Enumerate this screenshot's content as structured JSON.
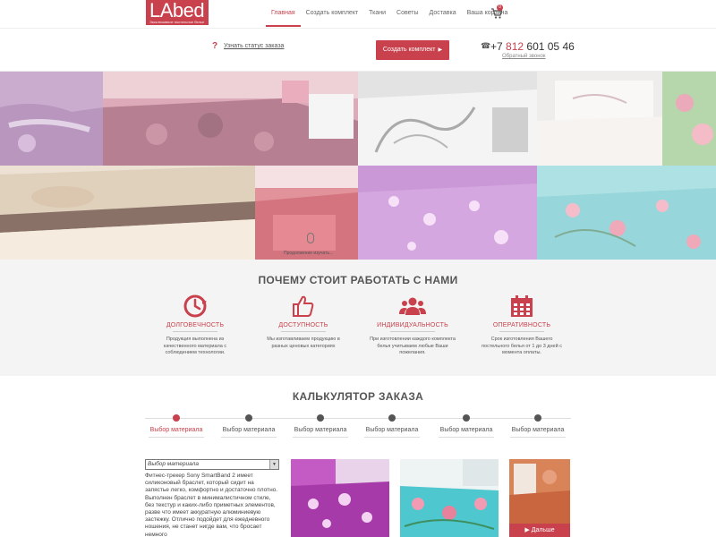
{
  "brand": {
    "name": "LAbed",
    "tagline": "Эксклюзивное постельное белье",
    "accent": "#c8414c"
  },
  "nav": {
    "items": [
      "Главная",
      "Создать комплект",
      "Ткани",
      "Советы",
      "Доставка",
      "Ваша корзина"
    ],
    "active": "Главная"
  },
  "cart": {
    "icon": "cart-icon",
    "count": "0"
  },
  "subbar": {
    "status_icon": "?",
    "status_link": "Узнать статус заказа",
    "create_button": "Создать комплект",
    "phone_icon": "☎",
    "phone_prefix": "+7",
    "phone_code": "812",
    "phone_number": "601 05 46",
    "callback": "Обратный звонок"
  },
  "hero": {
    "scroll_text": "Продолжение изучать..."
  },
  "why": {
    "title": "ПОЧЕМУ СТОИТ РАБОТАТЬ С НАМИ",
    "features": [
      {
        "icon": "durability-icon",
        "title": "ДОЛГОВЕЧНОСТЬ",
        "text": "Продукция выполнена из качественного материала с соблюдением технологии."
      },
      {
        "icon": "thumbs-up-icon",
        "title": "ДОСТУПНОСТЬ",
        "text": "Мы изготавливаем продукцию в разных ценовых категориях"
      },
      {
        "icon": "people-icon",
        "title": "ИНДИВИДУАЛЬНОСТЬ",
        "text": "При изготовлении каждого комплекта белья учитываем любые Ваши пожелания."
      },
      {
        "icon": "calendar-icon",
        "title": "ОПЕРАТИВНОСТЬ",
        "text": "Срок изготовления Вашего постельного белья от 1 до 3 дней с момента оплаты."
      }
    ]
  },
  "calculator": {
    "title": "КАЛЬКУЛЯТОР ЗАКАЗА",
    "steps": [
      "Выбор материала",
      "Выбор материала",
      "Выбор материала",
      "Выбор материала",
      "Выбор материала",
      "Выбор материала"
    ],
    "select_value": "Выбор материала",
    "description": "Фитнес-трекер Sony SmartBand 2 имеет силиконовый браслет, который сидит на запястье легко, комфортно и достаточно плотно. Выполнен браслет в минималистичном стиле, без текстур и каких-либо приметных элементов, разве что имеет аккуратную алюминиевую застежку. Отлично подойдет для ежедневного ношения, не станет нигде вам, что бросает немного",
    "next_button": "Дальше"
  }
}
